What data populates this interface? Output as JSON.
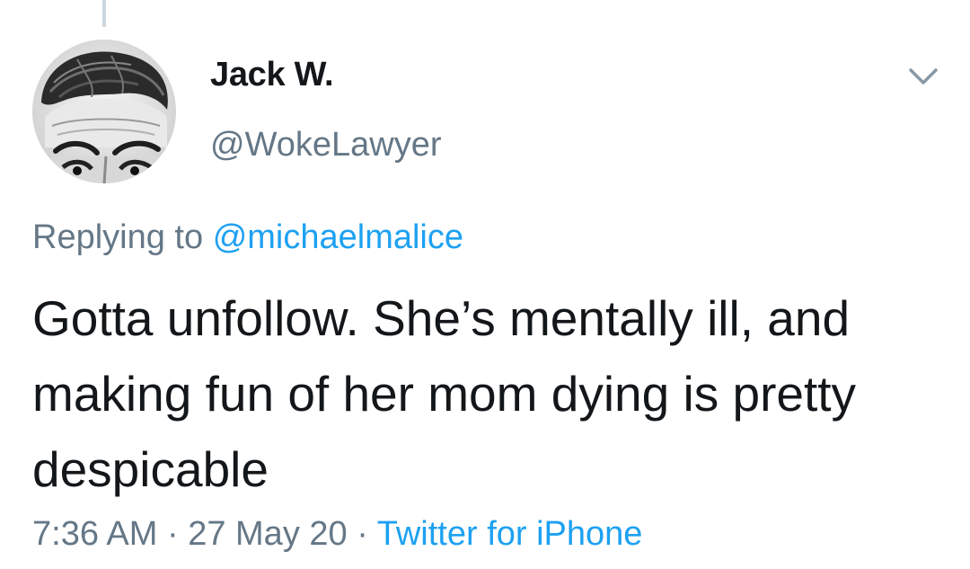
{
  "tweet": {
    "author": {
      "name": "Jack W.",
      "handle": "@WokeLawyer",
      "avatar_icon": "user-avatar-portrait"
    },
    "menu_icon": "chevron-down-icon",
    "reply": {
      "prefix": "Replying to",
      "mention": "@michaelmalice"
    },
    "text": "Gotta unfollow. She’s mentally ill, and making fun of her mom dying is pretty despicable",
    "time": "7:36 AM",
    "separator": "·",
    "date": "27 May 20",
    "source": "Twitter for iPhone"
  },
  "colors": {
    "text_primary": "#14171a",
    "text_secondary": "#657786",
    "link": "#1da1f2",
    "thread_line": "#ccd6dd"
  }
}
